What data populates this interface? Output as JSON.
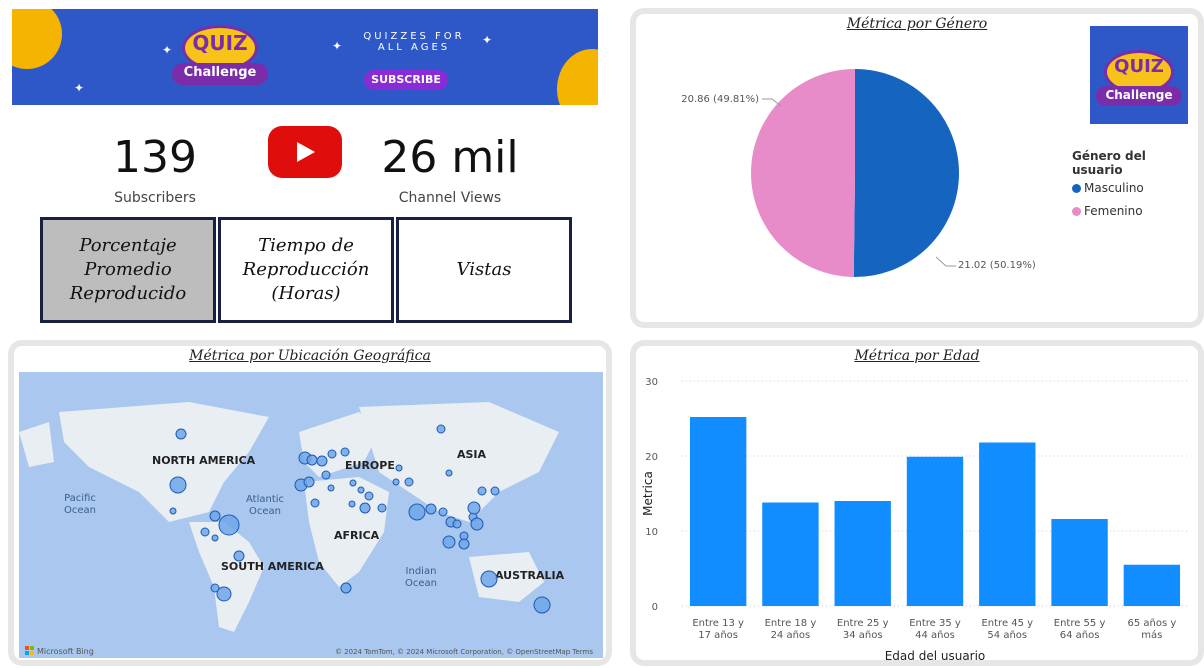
{
  "banner": {
    "logo_top": "QUIZ",
    "logo_bottom": "Challenge",
    "tagline_line1": "QUIZZES FOR",
    "tagline_line2": "ALL AGES",
    "subscribe_label": "SUBSCRIBE"
  },
  "stats": {
    "subscribers_value": "139",
    "subscribers_label": "Subscribers",
    "views_value": "26 mil",
    "views_label": "Channel Views"
  },
  "metric_buttons": [
    {
      "label": "Porcentaje Promedio Reproducido",
      "selected": true
    },
    {
      "label": "Tiempo de Reproducción (Horas)",
      "selected": false
    },
    {
      "label": "Vistas",
      "selected": false
    }
  ],
  "gender_chart": {
    "title": "Métrica por Género",
    "legend_title": "Género del usuario",
    "logo_top": "QUIZ",
    "logo_bottom": "Challenge",
    "chart_data": {
      "type": "pie",
      "slices": [
        {
          "label": "Masculino",
          "value": 21.02,
          "percent": 50.19,
          "color": "#1565c0",
          "data_label": "21.02 (50.19%)"
        },
        {
          "label": "Femenino",
          "value": 20.86,
          "percent": 49.81,
          "color": "#e88bc9",
          "data_label": "20.86 (49.81%)"
        }
      ]
    }
  },
  "map": {
    "title": "Métrica por Ubicación Geográfica",
    "regions": {
      "north_america": "NORTH AMERICA",
      "europe": "EUROPE",
      "asia": "ASIA",
      "africa": "AFRICA",
      "south_america": "SOUTH AMERICA",
      "australia": "AUSTRALIA"
    },
    "oceans": {
      "pacific_1": "Pacific",
      "pacific_2": "Ocean",
      "atlantic_1": "Atlantic",
      "atlantic_2": "Ocean",
      "indian_1": "Indian",
      "indian_2": "Ocean"
    },
    "bing_label": "Microsoft Bing",
    "copyright": "© 2024 TomTom, © 2024 Microsoft Corporation, © OpenStreetMap  Terms"
  },
  "age_chart": {
    "title": "Métrica por Edad",
    "chart_data": {
      "type": "bar",
      "xlabel": "Edad del usuario",
      "ylabel": "Metrica",
      "ylim": [
        0,
        30
      ],
      "yticks": [
        0,
        10,
        20,
        30
      ],
      "categories": [
        [
          "Entre 13 y",
          "17 años"
        ],
        [
          "Entre 18 y",
          "24 años"
        ],
        [
          "Entre 25 y",
          "34 años"
        ],
        [
          "Entre 35 y",
          "44 años"
        ],
        [
          "Entre 45 y",
          "54 años"
        ],
        [
          "Entre 55 y",
          "64 años"
        ],
        [
          "65 años y",
          "más"
        ]
      ],
      "values": [
        25.2,
        13.8,
        14.0,
        19.9,
        21.8,
        11.6,
        5.5
      ],
      "color": "#118dff"
    }
  }
}
